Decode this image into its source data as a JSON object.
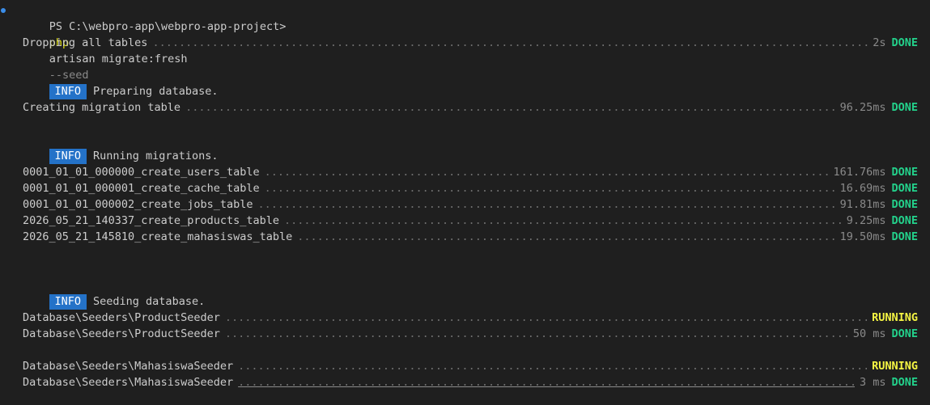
{
  "prompt": {
    "prefix": "PS C:\\webpro-app\\webpro-app-project>",
    "command": "php",
    "args": "artisan migrate:fresh",
    "flag": "--seed"
  },
  "tasks": {
    "drop": {
      "label": "Dropping all tables",
      "time": "2s",
      "status": "DONE"
    },
    "create_migration": {
      "label": "Creating migration table",
      "time": "96.25ms",
      "status": "DONE"
    },
    "m1": {
      "label": "0001_01_01_000000_create_users_table",
      "time": "161.76ms",
      "status": "DONE"
    },
    "m2": {
      "label": "0001_01_01_000001_create_cache_table",
      "time": "16.69ms",
      "status": "DONE"
    },
    "m3": {
      "label": "0001_01_01_000002_create_jobs_table",
      "time": "91.81ms",
      "status": "DONE"
    },
    "m4": {
      "label": "2026_05_21_140337_create_products_table",
      "time": "9.25ms",
      "status": "DONE"
    },
    "m5": {
      "label": "2026_05_21_145810_create_mahasiswas_table",
      "time": "19.50ms",
      "status": "DONE"
    },
    "s1": {
      "label": "Database\\Seeders\\ProductSeeder",
      "time": "",
      "status": "RUNNING"
    },
    "s2": {
      "label": "Database\\Seeders\\ProductSeeder",
      "time": "50 ms",
      "status": "DONE"
    },
    "s3": {
      "label": "Database\\Seeders\\MahasiswaSeeder",
      "time": "",
      "status": "RUNNING"
    },
    "s4": {
      "label": "Database\\Seeders\\MahasiswaSeeder",
      "time": "3 ms",
      "status": "DONE"
    }
  },
  "info": {
    "badge": "INFO",
    "preparing": "Preparing database.",
    "running": "Running migrations.",
    "seeding": "Seeding database."
  },
  "colors": {
    "background": "#1f1f1f",
    "done": "#23d18b",
    "running": "#f5f543",
    "info_badge": "#2472c8",
    "php": "#e5e510"
  }
}
